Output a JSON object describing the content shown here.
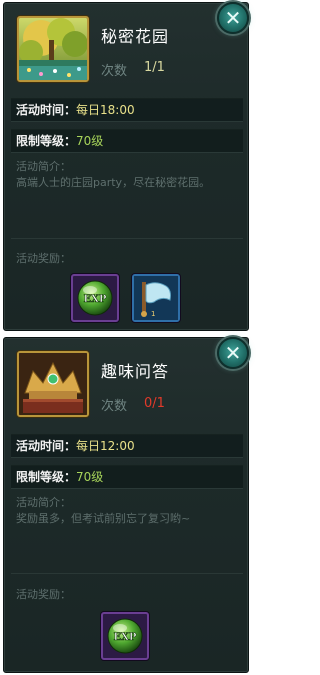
{
  "cards": [
    {
      "title": "秘密花园",
      "count_label": "次数",
      "count_value": "1/1",
      "time_label": "活动时间：",
      "time_value": "每日18:00",
      "level_label": "限制等级：",
      "level_value": "70级",
      "desc_label": "活动简介：",
      "desc_text": "高端人士的庄园party，尽在秘密花园。",
      "reward_label": "活动奖励：",
      "rewards": [
        {
          "icon": "exp-orb-icon",
          "text": "EXP"
        },
        {
          "icon": "flag-scroll-icon"
        }
      ]
    },
    {
      "title": "趣味问答",
      "count_label": "次数",
      "count_value": "0/1",
      "time_label": "活动时间：",
      "time_value": "每日12:00",
      "level_label": "限制等级：",
      "level_value": "70级",
      "desc_label": "活动简介：",
      "desc_text": "奖励虽多，但考试前别忘了复习哟~",
      "reward_label": "活动奖励：",
      "rewards": [
        {
          "icon": "exp-orb-icon",
          "text": "EXP"
        }
      ]
    }
  ],
  "colors": {
    "panel": "#1d2a29",
    "count_ok": "#d8d8a0",
    "count_zero": "#e23a2a",
    "time_value": "#e8e08a",
    "level_value": "#a7d45a",
    "close_button": "#206e67"
  },
  "close_icon": "close-icon"
}
